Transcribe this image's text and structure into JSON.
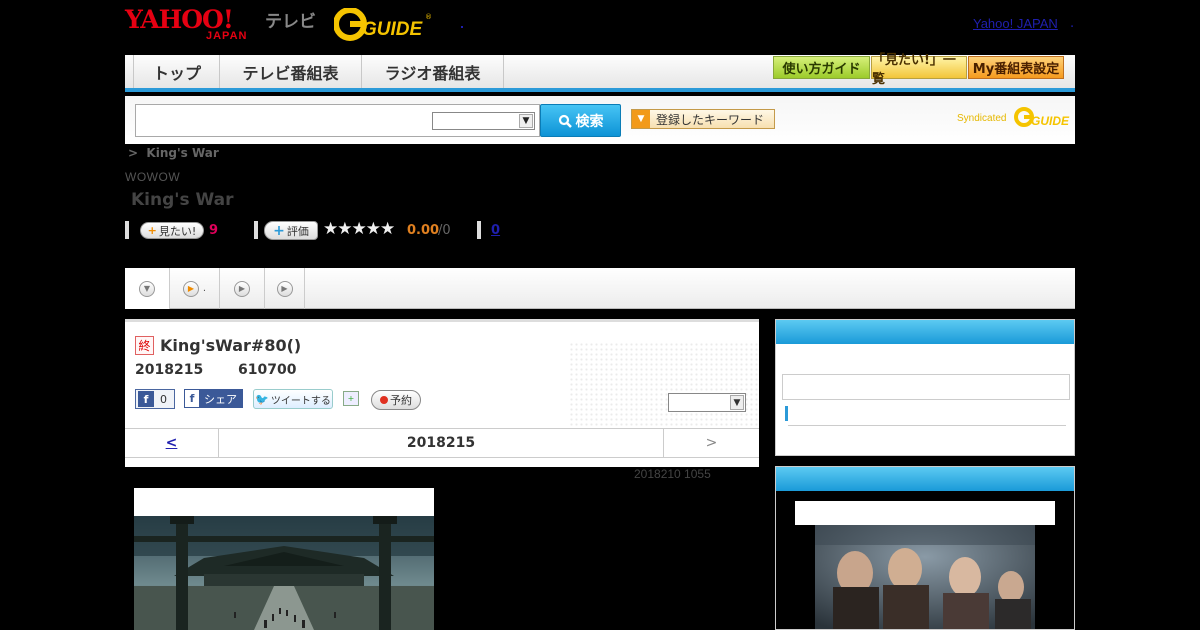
{
  "header": {
    "logo_main": "YAHOO!",
    "logo_sub": "JAPAN",
    "logo_tv": "テレビ",
    "logo_gguide": "G-GUIDE",
    "yahoo_japan_link": "Yahoo! JAPAN",
    "link_separator": "."
  },
  "nav": {
    "tabs": [
      {
        "label": "トップ"
      },
      {
        "label": "テレビ番組表"
      },
      {
        "label": "ラジオ番組表"
      }
    ],
    "guide_button": "使い方ガイド",
    "want_list_button": "「見たい!」一覧",
    "my_schedule_button": "My番組表設定"
  },
  "search": {
    "input_value": "",
    "select_value": "",
    "button_label": "検索",
    "keyword_button": "登録したキーワード",
    "syndicated_label": "Syndicated"
  },
  "program": {
    "breadcrumb_sep": ">",
    "breadcrumb_current": "King's War",
    "channel": "WOWOW",
    "title": "King's War",
    "want_label": "見たい!",
    "want_count": "9",
    "rate_label": "評価",
    "stars": "★★★★★",
    "score": "0.00",
    "score_count": "/0",
    "comment_count": "0"
  },
  "tabs": {
    "tab2_text": "."
  },
  "episode": {
    "end_badge": "終",
    "title": "King'sWar#80()",
    "date": "2018215",
    "time": "610700",
    "fb_like_count": "0",
    "fb_share_label": "シェア",
    "tweet_label": "ツイートする",
    "reserve_label": "予約",
    "select_value": "",
    "pager_prev": "<",
    "pager_current": "2018215",
    "pager_next": ">",
    "updated": "2018210  1055"
  },
  "colors": {
    "accent_blue": "#2b9ad8",
    "yahoo_red": "#e60012",
    "gguide_yellow": "#f5c400"
  }
}
